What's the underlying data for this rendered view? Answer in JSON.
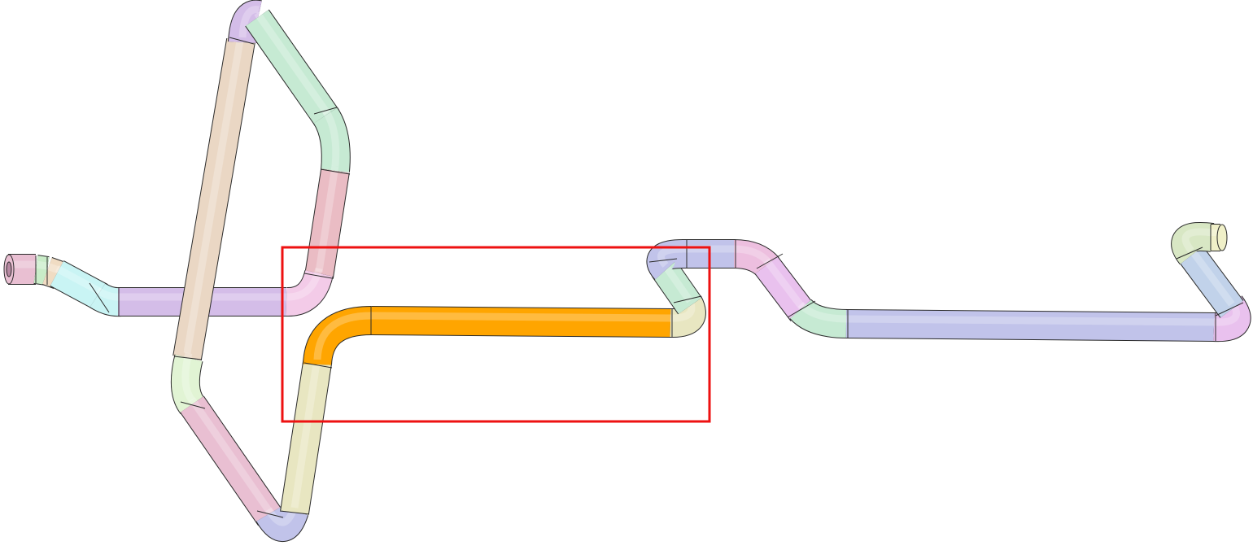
{
  "scene": {
    "background": "#ffffff",
    "outline_color": "#2a2a2a",
    "highlight_color": "#ffa500",
    "selection_color": "#ee1111",
    "segment_colors": {
      "pink": "#e9bfd2",
      "green_light": "#c9ecc8",
      "peach": "#f0dcc3",
      "cyan": "#c9f4f4",
      "lavender": "#d4bde8",
      "tan": "#ead7c4",
      "mint": "#c6ead3",
      "rose": "#eabcc4",
      "lilac": "#f3cbe8",
      "orange": "#ffa500",
      "khaki": "#e8e6c1",
      "periwinkle": "#c1c3ea",
      "mint_pale": "#e1f4d4",
      "pink_mauve": "#edbfdf",
      "violet_pink": "#e9c1ee",
      "steel_blue": "#c1d2ea",
      "sage": "#d8e7c4",
      "cream": "#f0f0c8"
    },
    "icons": {
      "pipe_inlet": "pipe-inlet-icon",
      "pipe_outlet": "pipe-outlet-icon"
    }
  }
}
